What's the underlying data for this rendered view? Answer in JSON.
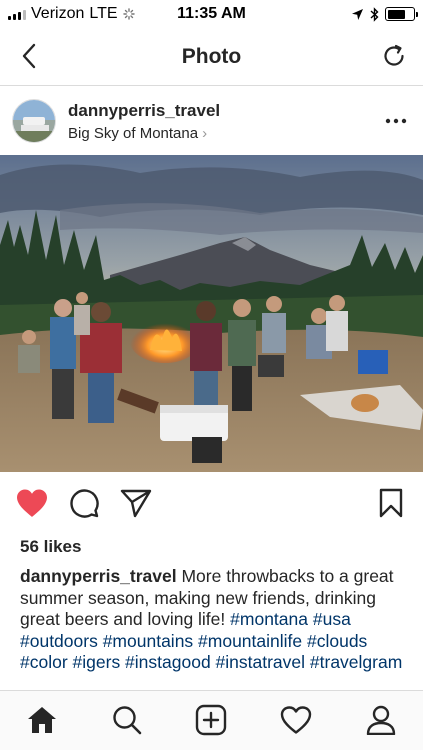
{
  "status_bar": {
    "carrier": "Verizon",
    "network": "LTE",
    "time": "11:35 AM",
    "battery_level": 0.7
  },
  "nav": {
    "title": "Photo"
  },
  "post": {
    "username": "dannyperris_travel",
    "location": "Big Sky of Montana",
    "likes": "56 likes",
    "caption_user": "dannyperris_travel",
    "caption_text": "More throwbacks to a great summer season, making new friends, drinking great beers and loving life!",
    "hashtags": "#montana #usa #outdoors #mountains #mountainlife #clouds #color #igers #instagood #instatravel #travelgram",
    "liked": true
  },
  "icons": {
    "back": "chevron-left-icon",
    "refresh": "refresh-icon",
    "more": "more-icon",
    "like": "heart-filled-icon",
    "comment": "comment-icon",
    "share": "paper-plane-icon",
    "save": "bookmark-icon",
    "home": "home-icon",
    "search": "search-icon",
    "add": "add-post-icon",
    "activity": "heart-outline-icon",
    "profile": "profile-icon"
  },
  "colors": {
    "like_red": "#ed4956",
    "hashtag_blue": "#003569",
    "text": "#262626",
    "divider": "#dbdbdb"
  }
}
